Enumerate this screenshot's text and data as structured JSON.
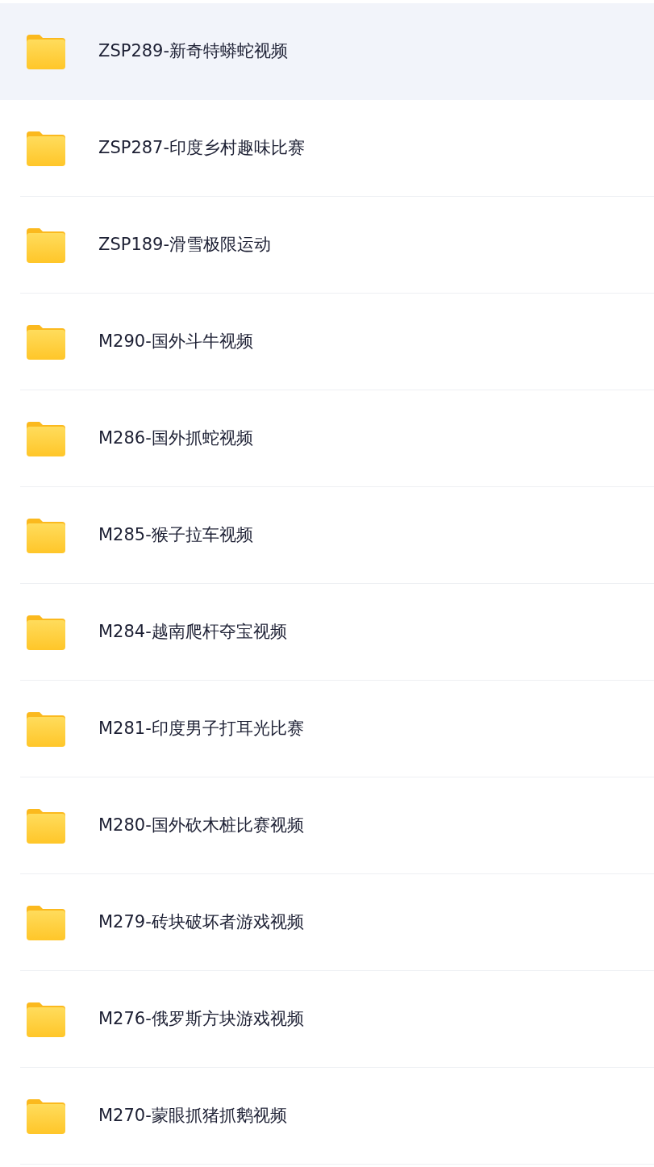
{
  "folders": [
    {
      "name": "ZSP289-新奇特蟒蛇视频",
      "selected": true
    },
    {
      "name": "ZSP287-印度乡村趣味比赛",
      "selected": false
    },
    {
      "name": "ZSP189-滑雪极限运动",
      "selected": false
    },
    {
      "name": "M290-国外斗牛视频",
      "selected": false
    },
    {
      "name": "M286-国外抓蛇视频",
      "selected": false
    },
    {
      "name": "M285-猴子拉车视频",
      "selected": false
    },
    {
      "name": "M284-越南爬杆夺宝视频",
      "selected": false
    },
    {
      "name": "M281-印度男子打耳光比赛",
      "selected": false
    },
    {
      "name": "M280-国外砍木桩比赛视频",
      "selected": false
    },
    {
      "name": "M279-砖块破坏者游戏视频",
      "selected": false
    },
    {
      "name": "M276-俄罗斯方块游戏视频",
      "selected": false
    },
    {
      "name": "M270-蒙眼抓猪抓鹅视频",
      "selected": false
    }
  ]
}
